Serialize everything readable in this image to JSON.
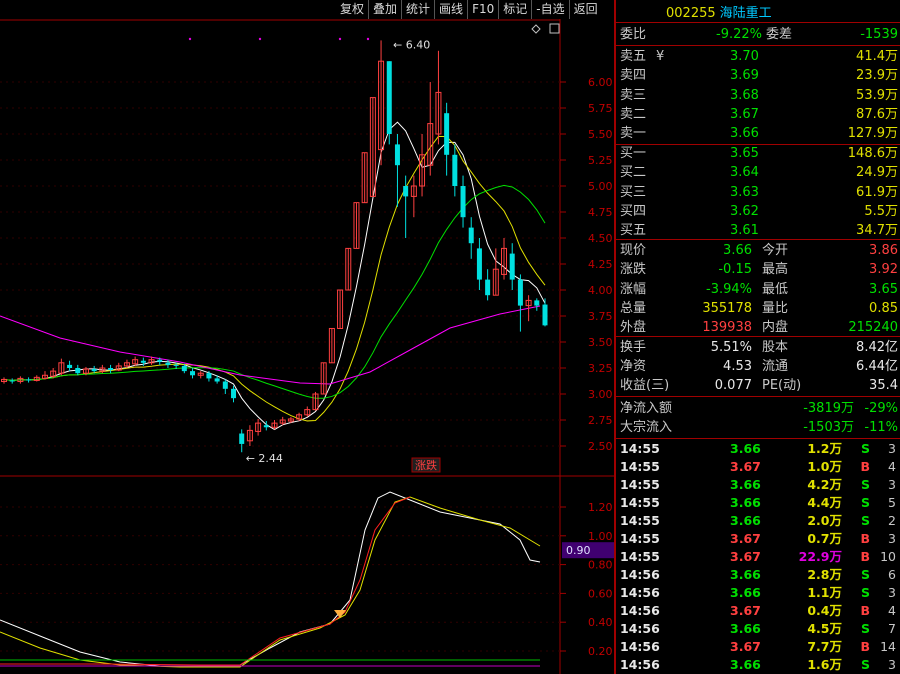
{
  "toolbar": {
    "buttons": [
      "复权",
      "叠加",
      "统计",
      "画线",
      "F10",
      "标记",
      "-自选",
      "返回"
    ]
  },
  "stock": {
    "code": "002255",
    "name": "海陆重工"
  },
  "chart": {
    "price_axis": [
      "6.00",
      "5.75",
      "5.50",
      "5.25",
      "5.00",
      "4.75",
      "4.50",
      "4.25",
      "4.00",
      "3.75",
      "3.50",
      "3.25",
      "3.00",
      "2.75",
      "2.50"
    ],
    "indicator_axis": [
      "1.20",
      "1.00",
      "0.80",
      "0.60",
      "0.40",
      "0.20"
    ],
    "high_label": "6.40",
    "low_label": "2.44",
    "mid_label": "涨跌",
    "current_indicator": "0.90",
    "colors": {
      "up": "#ff4040",
      "down": "#00e0e0",
      "ma5": "#ffffff",
      "ma10": "#e0e000",
      "ma20": "#00e000",
      "ma60": "#ff00ff"
    }
  },
  "quote": {
    "weibi": {
      "label": "委比",
      "value": "-9.22%",
      "label2": "委差",
      "value2": "-1539"
    },
    "sells": [
      {
        "label": "卖五",
        "price": "3.70",
        "vol": "41.4万",
        "mark": "¥"
      },
      {
        "label": "卖四",
        "price": "3.69",
        "vol": "23.9万"
      },
      {
        "label": "卖三",
        "price": "3.68",
        "vol": "53.9万"
      },
      {
        "label": "卖二",
        "price": "3.67",
        "vol": "87.6万"
      },
      {
        "label": "卖一",
        "price": "3.66",
        "vol": "127.9万"
      }
    ],
    "buys": [
      {
        "label": "买一",
        "price": "3.65",
        "vol": "148.6万"
      },
      {
        "label": "买二",
        "price": "3.64",
        "vol": "24.9万"
      },
      {
        "label": "买三",
        "price": "3.63",
        "vol": "61.9万"
      },
      {
        "label": "买四",
        "price": "3.62",
        "vol": "5.5万"
      },
      {
        "label": "买五",
        "price": "3.61",
        "vol": "34.7万"
      }
    ],
    "stats": [
      {
        "l1": "现价",
        "v1": "3.66",
        "l2": "今开",
        "v2": "3.86",
        "c1": "green",
        "c2": "red"
      },
      {
        "l1": "涨跌",
        "v1": "-0.15",
        "l2": "最高",
        "v2": "3.92",
        "c1": "green",
        "c2": "red"
      },
      {
        "l1": "涨幅",
        "v1": "-3.94%",
        "l2": "最低",
        "v2": "3.65",
        "c1": "green",
        "c2": "green"
      },
      {
        "l1": "总量",
        "v1": "355178",
        "l2": "量比",
        "v2": "0.85",
        "c1": "yellow",
        "c2": "yellow"
      },
      {
        "l1": "外盘",
        "v1": "139938",
        "l2": "内盘",
        "v2": "215240",
        "c1": "red",
        "c2": "green"
      }
    ],
    "fund": [
      {
        "l1": "换手",
        "v1": "5.51%",
        "l2": "股本",
        "v2": "8.42亿"
      },
      {
        "l1": "净资",
        "v1": "4.53",
        "l2": "流通",
        "v2": "6.44亿"
      },
      {
        "l1": "收益(三)",
        "v1": "0.077",
        "l2": "PE(动)",
        "v2": "35.4"
      }
    ],
    "flow": [
      {
        "label": "净流入额",
        "v1": "-3819万",
        "v2": "-29%"
      },
      {
        "label": "大宗流入",
        "v1": "-1503万",
        "v2": "-11%"
      }
    ]
  },
  "trades": [
    {
      "t": "14:55",
      "p": "3.66",
      "v": "1.2万",
      "s": "S",
      "n": "3"
    },
    {
      "t": "14:55",
      "p": "3.67",
      "v": "1.0万",
      "s": "B",
      "n": "4"
    },
    {
      "t": "14:55",
      "p": "3.66",
      "v": "4.2万",
      "s": "S",
      "n": "3"
    },
    {
      "t": "14:55",
      "p": "3.66",
      "v": "4.4万",
      "s": "S",
      "n": "5"
    },
    {
      "t": "14:55",
      "p": "3.66",
      "v": "2.0万",
      "s": "S",
      "n": "2"
    },
    {
      "t": "14:55",
      "p": "3.67",
      "v": "0.7万",
      "s": "B",
      "n": "3"
    },
    {
      "t": "14:55",
      "p": "3.67",
      "v": "22.9万",
      "s": "B",
      "n": "10"
    },
    {
      "t": "14:56",
      "p": "3.66",
      "v": "2.8万",
      "s": "S",
      "n": "6"
    },
    {
      "t": "14:56",
      "p": "3.66",
      "v": "1.1万",
      "s": "S",
      "n": "3"
    },
    {
      "t": "14:56",
      "p": "3.67",
      "v": "0.4万",
      "s": "B",
      "n": "4"
    },
    {
      "t": "14:56",
      "p": "3.66",
      "v": "4.5万",
      "s": "S",
      "n": "7"
    },
    {
      "t": "14:56",
      "p": "3.67",
      "v": "7.7万",
      "s": "B",
      "n": "14"
    },
    {
      "t": "14:56",
      "p": "3.66",
      "v": "1.6万",
      "s": "S",
      "n": "3"
    }
  ]
}
